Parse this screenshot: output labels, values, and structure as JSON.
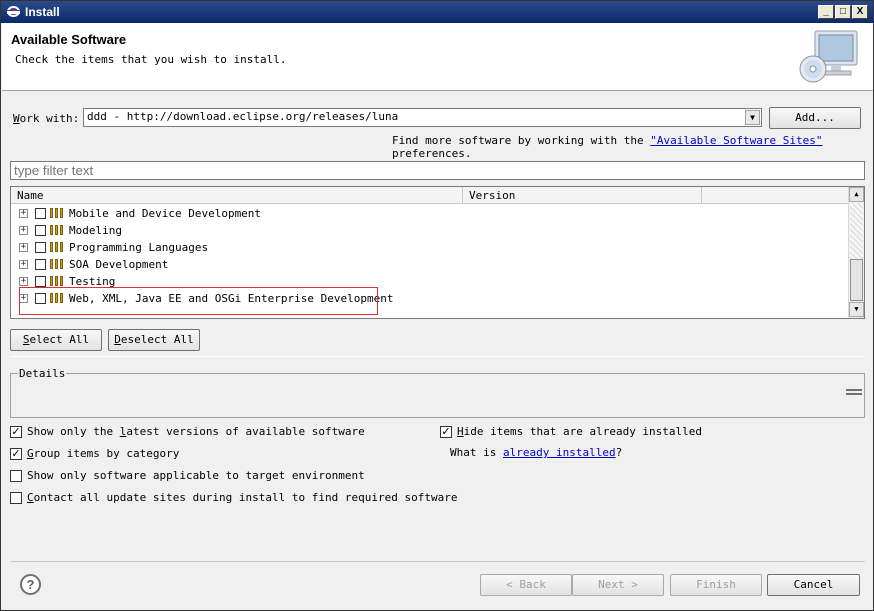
{
  "window": {
    "title": "Install",
    "min_glyph": "_",
    "max_glyph": "□",
    "close_glyph": "X"
  },
  "header": {
    "title": "Available Software",
    "description": "Check the items that you wish to install."
  },
  "work_with": {
    "label_key": "W",
    "label_rest": "ork with:",
    "value": "ddd - http://download.eclipse.org/releases/luna",
    "dropdown_arrow": "▼",
    "add_button": "Add..."
  },
  "sites_hint": {
    "prefix": "Find more software by working with the ",
    "link": "\"Available Software Sites\"",
    "suffix": " preferences."
  },
  "filter": {
    "placeholder": "type filter text"
  },
  "table": {
    "columns": [
      "Name",
      "Version"
    ],
    "expander_glyph": "+",
    "rows": [
      "Mobile and Device Development",
      "Modeling",
      "Programming Languages",
      "SOA Development",
      "Testing",
      "Web, XML, Java EE and OSGi Enterprise Development"
    ],
    "scroll_up": "▲",
    "scroll_down": "▼"
  },
  "selection_buttons": {
    "select_all_key": "S",
    "select_all_rest": "elect All",
    "deselect_all_key": "D",
    "deselect_all_rest": "eselect All"
  },
  "details": {
    "legend": "Details"
  },
  "options": {
    "latest_versions": {
      "checked": true,
      "pre": "Show only the ",
      "key": "l",
      "post": "atest versions of available software"
    },
    "group_by_category": {
      "checked": true,
      "pre": "",
      "key": "G",
      "post": "roup items by category"
    },
    "target_env": {
      "checked": false,
      "label": "Show only software applicable to target environment"
    },
    "contact_sites": {
      "checked": false,
      "pre": "",
      "key": "C",
      "post": "ontact all update sites during install to find required software"
    },
    "hide_installed": {
      "checked": true,
      "pre": "",
      "key": "H",
      "post": "ide items that are already installed"
    },
    "what_is": {
      "prefix": "What is ",
      "link": "already installed",
      "suffix": "?"
    },
    "check_glyph": "✓"
  },
  "footer": {
    "help": "?",
    "back": "< Back",
    "back_key": "B",
    "next": "Next >",
    "next_key": "N",
    "finish": "Finish",
    "finish_key": "F",
    "cancel": "Cancel"
  }
}
